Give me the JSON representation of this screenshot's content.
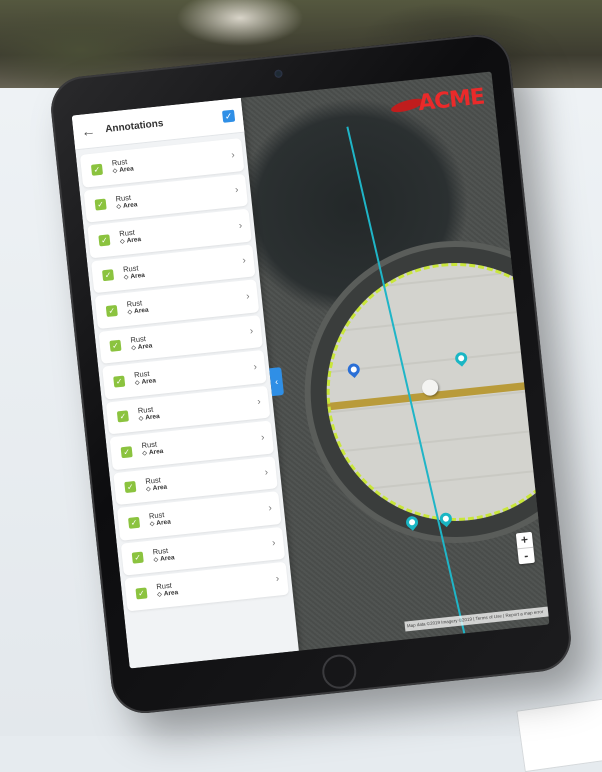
{
  "sidebar": {
    "title": "Annotations",
    "back_icon": "arrow-left-icon",
    "select_all_checked": true,
    "items": [
      {
        "label": "Rust",
        "type": "Area"
      },
      {
        "label": "Rust",
        "type": "Area"
      },
      {
        "label": "Rust",
        "type": "Area"
      },
      {
        "label": "Rust",
        "type": "Area"
      },
      {
        "label": "Rust",
        "type": "Area"
      },
      {
        "label": "Rust",
        "type": "Area"
      },
      {
        "label": "Rust",
        "type": "Area"
      },
      {
        "label": "Rust",
        "type": "Area"
      },
      {
        "label": "Rust",
        "type": "Area"
      },
      {
        "label": "Rust",
        "type": "Area"
      },
      {
        "label": "Rust",
        "type": "Area"
      },
      {
        "label": "Rust",
        "type": "Area"
      },
      {
        "label": "Rust",
        "type": "Area"
      }
    ]
  },
  "map": {
    "logo_text": "ACME",
    "zoom_in": "+",
    "zoom_out": "-",
    "attribution": "Map data ©2019 Imagery ©2019 | Terms of Use | Report a map error",
    "collapse_icon": "‹"
  },
  "colors": {
    "accent_blue": "#2f8fe6",
    "check_green": "#8bc33f",
    "section_line": "#1fb5c7",
    "logo_red": "#ea2a2a"
  }
}
